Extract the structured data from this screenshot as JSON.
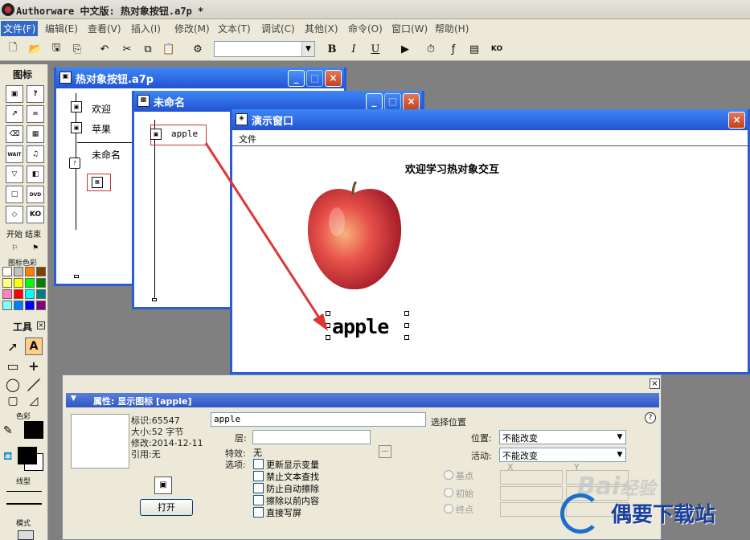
{
  "app": {
    "title": "Authorware 中文版: 热对象按钮.a7p *"
  },
  "menu": [
    "文件(F)",
    "编辑(E)",
    "查看(V)",
    "插入(I)",
    "修改(M)",
    "文本(T)",
    "调试(C)",
    "其他(X)",
    "命令(O)",
    "窗口(W)",
    "帮助(H)"
  ],
  "toolbar": {
    "font_value": "",
    "bold": "B",
    "italic": "I",
    "underline": "U"
  },
  "palette": {
    "title": "图标",
    "icons": [
      "display",
      "interaction?",
      "calc",
      "wait",
      "map",
      "motion",
      "WAIT",
      "digital movie",
      "decision",
      "video",
      "framework",
      "DVD",
      "erase",
      "KO"
    ],
    "start_end": "开始 结束",
    "color_title": "图标色彩",
    "colors": [
      "#ffffff",
      "#c0c0c0",
      "#ff8000",
      "#804000",
      "#ffff80",
      "#ffff00",
      "#00ff00",
      "#008000",
      "#ff80c0",
      "#ff0000",
      "#00ffff",
      "#008080",
      "#80ffff",
      "#0080ff",
      "#0000ff",
      "#800080"
    ]
  },
  "tools": {
    "title": "工具",
    "color_label": "色彩",
    "line_label": "线型",
    "mode_label": "模式"
  },
  "flow_window": {
    "title": "热对象按钮.a7p",
    "items": [
      "欢迎",
      "苹果",
      "未命名"
    ]
  },
  "sub_window": {
    "title": "未命名",
    "item": "apple"
  },
  "presentation": {
    "title": "演示窗口",
    "menu": "文件",
    "heading": "欢迎学习热对象交互",
    "text": "apple"
  },
  "props": {
    "title": "属性: 显示图标 [apple]",
    "id": "标识:65547",
    "size": "大小:52 字节",
    "modified": "修改:2014-12-11",
    "ref": "引用:无",
    "name_value": "apple",
    "layer_label": "层:",
    "effect_label": "特效:",
    "effect_value": "无",
    "options_label": "选项:",
    "options": [
      "更新显示变量",
      "禁止文本查找",
      "防止自动擦除",
      "擦除以前内容",
      "直接写屏"
    ],
    "select_pos": "选择位置",
    "position_label": "位置:",
    "position_value": "不能改变",
    "active_label": "活动:",
    "active_value": "不能改变",
    "radios": [
      "基点",
      "初始",
      "终点"
    ],
    "x_label": "X",
    "y_label": "Y",
    "open_button": "打开",
    "help": "?"
  },
  "watermark": {
    "brand": "Bai",
    "brand2": "经验",
    "site": "偶要下载站"
  }
}
